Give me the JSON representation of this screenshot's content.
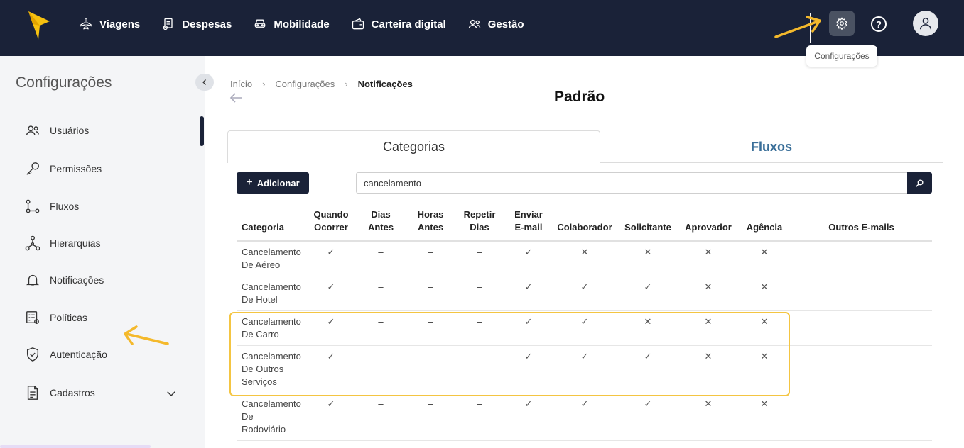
{
  "nav": {
    "items": [
      {
        "label": "Viagens",
        "icon": "airplane-icon"
      },
      {
        "label": "Despesas",
        "icon": "receipt-icon"
      },
      {
        "label": "Mobilidade",
        "icon": "car-icon"
      },
      {
        "label": "Carteira digital",
        "icon": "wallet-icon"
      },
      {
        "label": "Gestão",
        "icon": "users-icon"
      }
    ],
    "tooltip": "Configurações",
    "help": "?"
  },
  "sidebar": {
    "title": "Configurações",
    "items": [
      {
        "label": "Usuários",
        "icon": "users-icon"
      },
      {
        "label": "Permissões",
        "icon": "key-icon"
      },
      {
        "label": "Fluxos",
        "icon": "flow-icon"
      },
      {
        "label": "Hierarquias",
        "icon": "hierarchy-icon"
      },
      {
        "label": "Notificações",
        "icon": "bell-icon"
      },
      {
        "label": "Políticas",
        "icon": "policy-icon"
      },
      {
        "label": "Autenticação",
        "icon": "shield-icon"
      },
      {
        "label": "Cadastros",
        "icon": "document-icon"
      }
    ]
  },
  "breadcrumb": {
    "items": [
      "Início",
      "Configurações",
      "Notificações"
    ]
  },
  "page": {
    "title": "Padrão"
  },
  "tabs": {
    "active": "Categorias",
    "other": "Fluxos"
  },
  "toolbar": {
    "add_label": "Adicionar",
    "search_value": "cancelamento"
  },
  "table": {
    "headers": {
      "categoria": "Categoria",
      "quando1": "Quando",
      "quando2": "Ocorrer",
      "dias1": "Dias",
      "dias2": "Antes",
      "horas1": "Horas",
      "horas2": "Antes",
      "repetir1": "Repetir",
      "repetir2": "Dias",
      "enviar1": "Enviar",
      "enviar2": "E-mail",
      "colaborador": "Colaborador",
      "solicitante": "Solicitante",
      "aprovador": "Aprovador",
      "agencia": "Agência",
      "outros": "Outros E-mails"
    },
    "rows": [
      {
        "cat": [
          "Cancelamento",
          "De Aéreo"
        ],
        "vals": [
          "✓",
          "–",
          "–",
          "–",
          "✓",
          "✕",
          "✕",
          "✕",
          "✕"
        ]
      },
      {
        "cat": [
          "Cancelamento",
          "De Hotel"
        ],
        "vals": [
          "✓",
          "–",
          "–",
          "–",
          "✓",
          "✓",
          "✓",
          "✕",
          "✕"
        ]
      },
      {
        "cat": [
          "Cancelamento",
          "De Carro"
        ],
        "vals": [
          "✓",
          "–",
          "–",
          "–",
          "✓",
          "✓",
          "✕",
          "✕",
          "✕"
        ]
      },
      {
        "cat": [
          "Cancelamento",
          "De Outros",
          "Serviços"
        ],
        "vals": [
          "✓",
          "–",
          "–",
          "–",
          "✓",
          "✓",
          "✓",
          "✕",
          "✕"
        ]
      },
      {
        "cat": [
          "Cancelamento",
          "De",
          "Rodoviário"
        ],
        "vals": [
          "✓",
          "–",
          "–",
          "–",
          "✓",
          "✓",
          "✓",
          "✕",
          "✕"
        ]
      }
    ]
  },
  "colors": {
    "navy": "#1a2238",
    "highlight": "#f4c542",
    "tab_link": "#3a6f99"
  }
}
